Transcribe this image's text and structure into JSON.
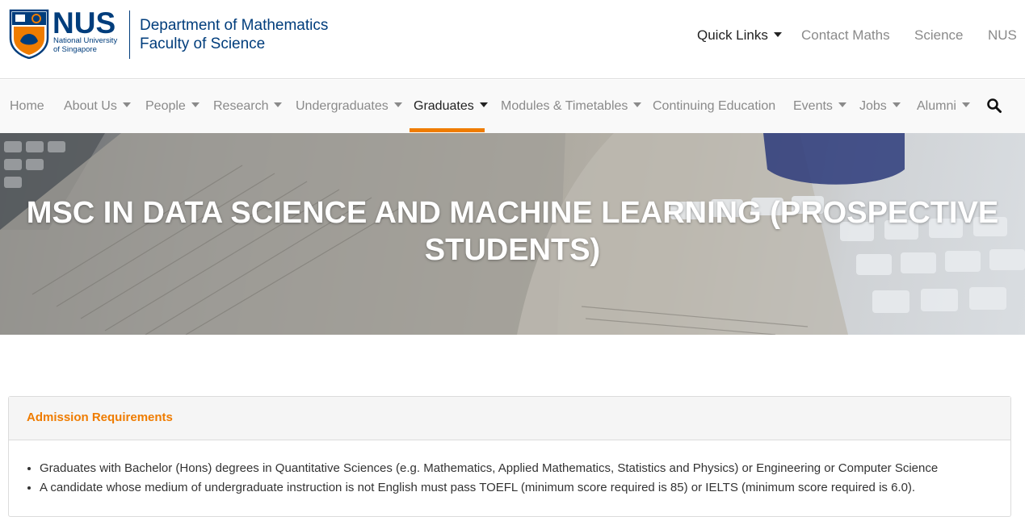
{
  "header": {
    "logo_text": "NUS",
    "logo_sub_line1": "National University",
    "logo_sub_line2": "of Singapore",
    "dept_line1": "Department of Mathematics",
    "dept_line2": "Faculty of Science",
    "quick_links": "Quick Links",
    "top_links": [
      "Contact Maths",
      "Science",
      "NUS"
    ]
  },
  "nav": {
    "items": [
      "Home",
      "About Us",
      "People",
      "Research",
      "Undergraduates",
      "Graduates",
      "Modules & Timetables",
      "Continuing Education",
      "Events",
      "Jobs",
      "Alumni"
    ],
    "active": "Graduates",
    "search_icon": "search-icon"
  },
  "hero": {
    "title": "MSC IN DATA SCIENCE AND MACHINE LEARNING (PROSPECTIVE STUDENTS)"
  },
  "panel": {
    "title": "Admission Requirements",
    "items": [
      "Graduates with Bachelor (Hons) degrees in Quantitative Sciences (e.g. Mathematics, Applied Mathematics, Statistics and Physics) or Engineering or Computer Science",
      "A candidate whose medium of undergraduate instruction is not English must pass TOEFL (minimum score required is 85) or IELTS (minimum score required is 6.0)."
    ]
  },
  "colors": {
    "brand_blue": "#003d7c",
    "accent_orange": "#ef7c00"
  }
}
